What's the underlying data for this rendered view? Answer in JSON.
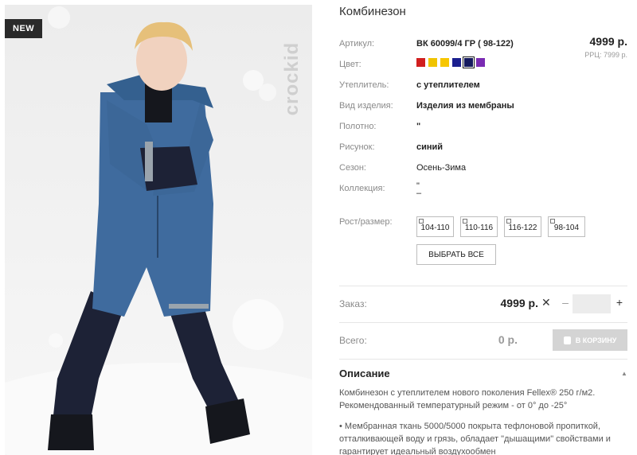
{
  "product": {
    "badge": "NEW",
    "brand": "crockid",
    "title": "Комбинезон",
    "price": "4999 р.",
    "rrp": "РРЦ: 7999 р."
  },
  "attributes": [
    {
      "label": "Артикул:",
      "value": "ВК 60099/4 ГР ( 98-122)",
      "bold": true
    },
    {
      "label": "Цвет:",
      "value": "",
      "bold": true
    },
    {
      "label": "Утеплитель:",
      "value": "с утеплителем",
      "bold": true
    },
    {
      "label": "Вид изделия:",
      "value": "Изделия из мембраны",
      "bold": true
    },
    {
      "label": "Полотно:",
      "value": "\"",
      "bold": true
    },
    {
      "label": "Рисунок:",
      "value": "синий",
      "bold": true
    },
    {
      "label": "Сезон:",
      "value": "Осень-Зима",
      "bold": false
    },
    {
      "label": "Коллекция:",
      "value": "\" –",
      "bold": false
    }
  ],
  "colors": [
    {
      "hex": "#d11f1f",
      "selected": false
    },
    {
      "hex": "#f0c400",
      "selected": false
    },
    {
      "hex": "#f7c600",
      "selected": false
    },
    {
      "hex": "#1b1f8f",
      "selected": false
    },
    {
      "hex": "#151a5e",
      "selected": true
    },
    {
      "hex": "#7a2bb3",
      "selected": false
    }
  ],
  "sizes": {
    "label": "Рост/размер:",
    "options": [
      "104-110",
      "110-116",
      "116-122",
      "98-104"
    ],
    "select_all": "ВЫБРАТЬ ВСЕ"
  },
  "order": {
    "label": "Заказ:",
    "price": "4999 р.",
    "times": "✕",
    "minus": "–",
    "plus": "+",
    "quantity": ""
  },
  "total": {
    "label": "Всего:",
    "value": "0 р.",
    "cart_button": "В КОРЗИНУ"
  },
  "description": {
    "title": "Описание",
    "caret": "▲",
    "paragraphs": [
      "Комбинезон с утеплителем нового поколения Fellex® 250 г/м2. Рекомендованный температурный режим - от 0° до -25°",
      "• Мембранная ткань 5000/5000 покрыта тефлоновой пропиткой, отталкивающей воду и грязь, обладает \"дышащими\" свойствами и гарантирует идеальный воздухообмен"
    ]
  },
  "icons": {
    "cart": "cart-icon",
    "checkbox": "checkbox-icon",
    "collapse": "caret-up-icon"
  }
}
